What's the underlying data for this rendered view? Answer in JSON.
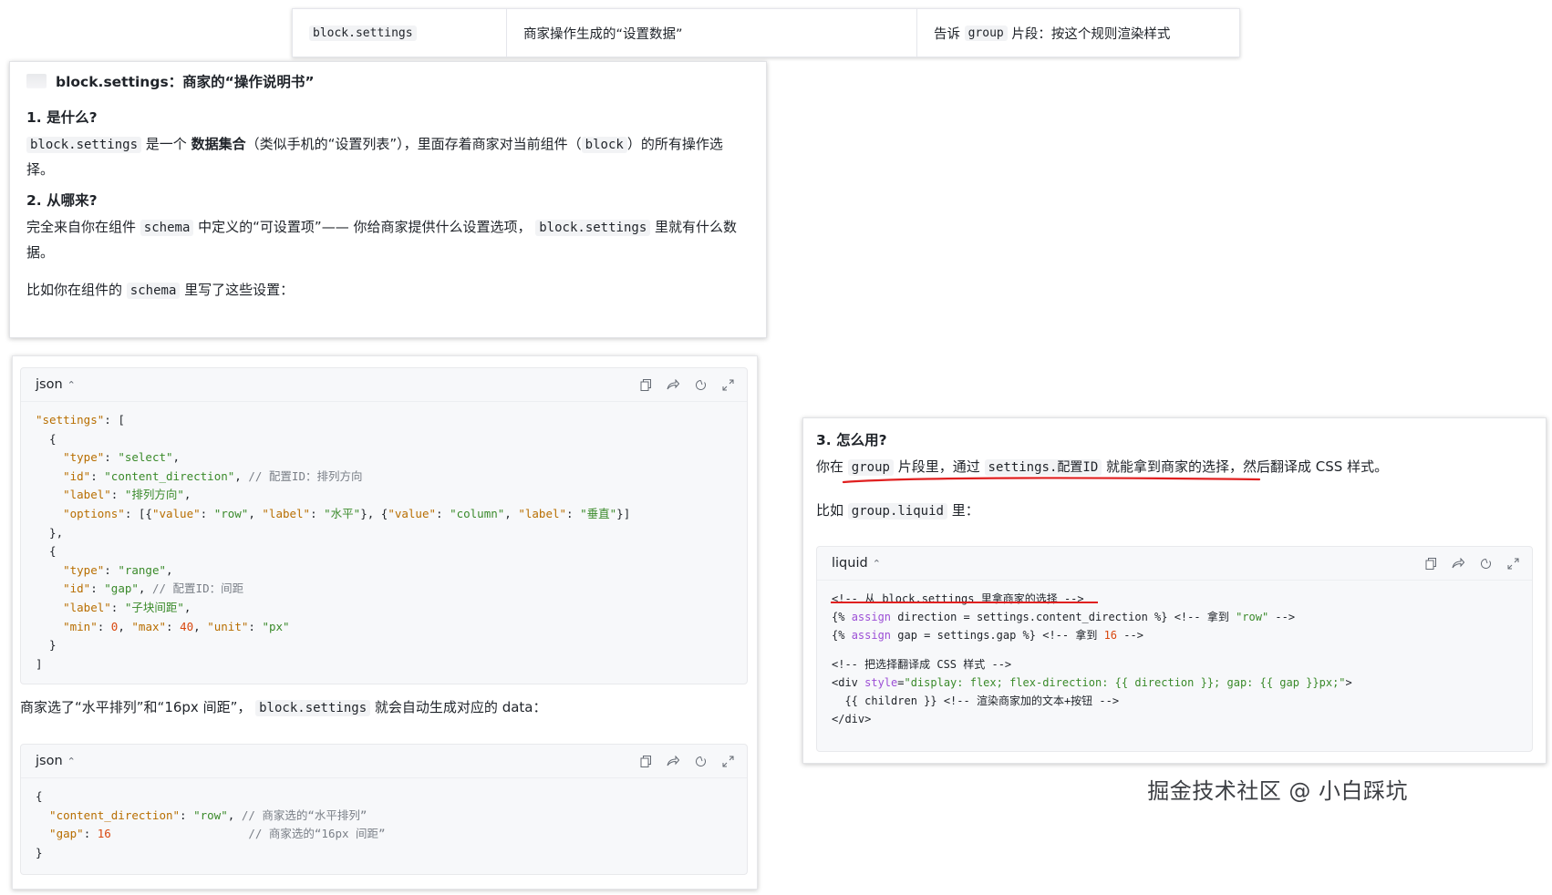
{
  "top_table": {
    "col1": "block.settings",
    "col2": "商家操作生成的“设置数据”",
    "col3_before": "告诉",
    "col3_code": "group",
    "col3_after": "片段：按这个规则渲染样式"
  },
  "card1": {
    "title": "block.settings：商家的“操作说明书”",
    "h1": "1. 是什么?",
    "p1_code": "block.settings",
    "p1_mid": "是一个",
    "p1_bold": "数据集合",
    "p1_rest": "（类似手机的“设置列表”），里面存着商家对当前组件（",
    "p1_code2": "block",
    "p1_tail": "）的所有操作选择。",
    "h2": "2. 从哪来?",
    "p2_a": "完全来自你在组件",
    "p2_code": "schema",
    "p2_b": "中定义的“可设置项”—— 你给商家提供什么设置选项，",
    "p2_code2": "block.settings",
    "p2_c": "里就有什么数据。",
    "p3_a": "比如你在组件的",
    "p3_code": "schema",
    "p3_b": "里写了这些设置："
  },
  "codeblock1": {
    "lang": "json",
    "lines": [
      [
        {
          "t": "\"settings\"",
          "c": "k"
        },
        {
          "t": ": [",
          "c": "pl"
        }
      ],
      [
        {
          "t": "  {",
          "c": "pl"
        }
      ],
      [
        {
          "t": "    \"type\"",
          "c": "k"
        },
        {
          "t": ": ",
          "c": "pl"
        },
        {
          "t": "\"select\"",
          "c": "s"
        },
        {
          "t": ",",
          "c": "pl"
        }
      ],
      [
        {
          "t": "    \"id\"",
          "c": "k"
        },
        {
          "t": ": ",
          "c": "pl"
        },
        {
          "t": "\"content_direction\"",
          "c": "s"
        },
        {
          "t": ", ",
          "c": "pl"
        },
        {
          "t": "// 配置ID：排列方向",
          "c": "c"
        }
      ],
      [
        {
          "t": "    \"label\"",
          "c": "k"
        },
        {
          "t": ": ",
          "c": "pl"
        },
        {
          "t": "\"排列方向\"",
          "c": "s"
        },
        {
          "t": ",",
          "c": "pl"
        }
      ],
      [
        {
          "t": "    \"options\"",
          "c": "k"
        },
        {
          "t": ": [{",
          "c": "pl"
        },
        {
          "t": "\"value\"",
          "c": "k"
        },
        {
          "t": ": ",
          "c": "pl"
        },
        {
          "t": "\"row\"",
          "c": "s"
        },
        {
          "t": ", ",
          "c": "pl"
        },
        {
          "t": "\"label\"",
          "c": "k"
        },
        {
          "t": ": ",
          "c": "pl"
        },
        {
          "t": "\"水平\"",
          "c": "s"
        },
        {
          "t": "}, {",
          "c": "pl"
        },
        {
          "t": "\"value\"",
          "c": "k"
        },
        {
          "t": ": ",
          "c": "pl"
        },
        {
          "t": "\"column\"",
          "c": "s"
        },
        {
          "t": ", ",
          "c": "pl"
        },
        {
          "t": "\"label\"",
          "c": "k"
        },
        {
          "t": ": ",
          "c": "pl"
        },
        {
          "t": "\"垂直\"",
          "c": "s"
        },
        {
          "t": "}]",
          "c": "pl"
        }
      ],
      [
        {
          "t": "  },",
          "c": "pl"
        }
      ],
      [
        {
          "t": "  {",
          "c": "pl"
        }
      ],
      [
        {
          "t": "    \"type\"",
          "c": "k"
        },
        {
          "t": ": ",
          "c": "pl"
        },
        {
          "t": "\"range\"",
          "c": "s"
        },
        {
          "t": ",",
          "c": "pl"
        }
      ],
      [
        {
          "t": "    \"id\"",
          "c": "k"
        },
        {
          "t": ": ",
          "c": "pl"
        },
        {
          "t": "\"gap\"",
          "c": "s"
        },
        {
          "t": ", ",
          "c": "pl"
        },
        {
          "t": "// 配置ID：间距",
          "c": "c"
        }
      ],
      [
        {
          "t": "    \"label\"",
          "c": "k"
        },
        {
          "t": ": ",
          "c": "pl"
        },
        {
          "t": "\"子块间距\"",
          "c": "s"
        },
        {
          "t": ",",
          "c": "pl"
        }
      ],
      [
        {
          "t": "    \"min\"",
          "c": "k"
        },
        {
          "t": ": ",
          "c": "pl"
        },
        {
          "t": "0",
          "c": "n"
        },
        {
          "t": ", ",
          "c": "pl"
        },
        {
          "t": "\"max\"",
          "c": "k"
        },
        {
          "t": ": ",
          "c": "pl"
        },
        {
          "t": "40",
          "c": "n"
        },
        {
          "t": ", ",
          "c": "pl"
        },
        {
          "t": "\"unit\"",
          "c": "k"
        },
        {
          "t": ": ",
          "c": "pl"
        },
        {
          "t": "\"px\"",
          "c": "s"
        }
      ],
      [
        {
          "t": "  }",
          "c": "pl"
        }
      ],
      [
        {
          "t": "]",
          "c": "pl"
        }
      ]
    ]
  },
  "between": {
    "a": "商家选了“水平排列”和“16px 间距”，",
    "code": "block.settings",
    "b": "就会自动生成对应的 data："
  },
  "codeblock2": {
    "lang": "json",
    "lines": [
      [
        {
          "t": "{",
          "c": "pl"
        }
      ],
      [
        {
          "t": "  \"content_direction\"",
          "c": "k"
        },
        {
          "t": ": ",
          "c": "pl"
        },
        {
          "t": "\"row\"",
          "c": "s"
        },
        {
          "t": ", ",
          "c": "pl"
        },
        {
          "t": "// 商家选的“水平排列”",
          "c": "c"
        }
      ],
      [
        {
          "t": "  \"gap\"",
          "c": "k"
        },
        {
          "t": ": ",
          "c": "pl"
        },
        {
          "t": "16",
          "c": "n"
        },
        {
          "t": "                    ",
          "c": "pl"
        },
        {
          "t": "// 商家选的“16px 间距”",
          "c": "c"
        }
      ],
      [
        {
          "t": "}",
          "c": "pl"
        }
      ]
    ]
  },
  "card3": {
    "h3": "3. 怎么用?",
    "p1_a": "你在",
    "p1_code1": "group",
    "p1_b": "片段里，通过",
    "p1_code2": "settings.配置ID",
    "p1_c": "就能拿到商家的选择，然后翻译成 CSS 样式。",
    "p2_a": "比如",
    "p2_code": "group.liquid",
    "p2_b": "里："
  },
  "codeblock3": {
    "lang": "liquid",
    "lines": [
      [
        {
          "t": "<!-- 从 block.settings 里拿商家的选择 -->",
          "c": "pl"
        }
      ],
      [
        {
          "t": "{% ",
          "c": "pl"
        },
        {
          "t": "assign",
          "c": "kw"
        },
        {
          "t": " direction = settings.content_direction %} <!-- 拿到 ",
          "c": "pl"
        },
        {
          "t": "\"row\"",
          "c": "s"
        },
        {
          "t": " -->",
          "c": "pl"
        }
      ],
      [
        {
          "t": "{% ",
          "c": "pl"
        },
        {
          "t": "assign",
          "c": "kw"
        },
        {
          "t": " gap = settings.gap %} <!-- 拿到 ",
          "c": "pl"
        },
        {
          "t": "16",
          "c": "n"
        },
        {
          "t": " -->",
          "c": "pl"
        }
      ],
      [
        {
          "t": "",
          "c": "pl"
        }
      ],
      [
        {
          "t": "<!-- 把选择翻译成 CSS 样式 -->",
          "c": "pl"
        }
      ],
      [
        {
          "t": "<div ",
          "c": "pl"
        },
        {
          "t": "style",
          "c": "kw"
        },
        {
          "t": "=",
          "c": "pl"
        },
        {
          "t": "\"display: flex; flex-direction: {{ direction }}; gap: {{ gap }}px;\"",
          "c": "s"
        },
        {
          "t": ">",
          "c": "pl"
        }
      ],
      [
        {
          "t": "  {{ children }} <!-- 渲染商家加的文本+按钮 -->",
          "c": "pl"
        }
      ],
      [
        {
          "t": "</div>",
          "c": "pl"
        }
      ]
    ]
  },
  "watermark": "掘金技术社区 @ 小白踩坑",
  "colors": {
    "annotation_red": "#e02020",
    "code_bg": "#f7f8fa"
  }
}
